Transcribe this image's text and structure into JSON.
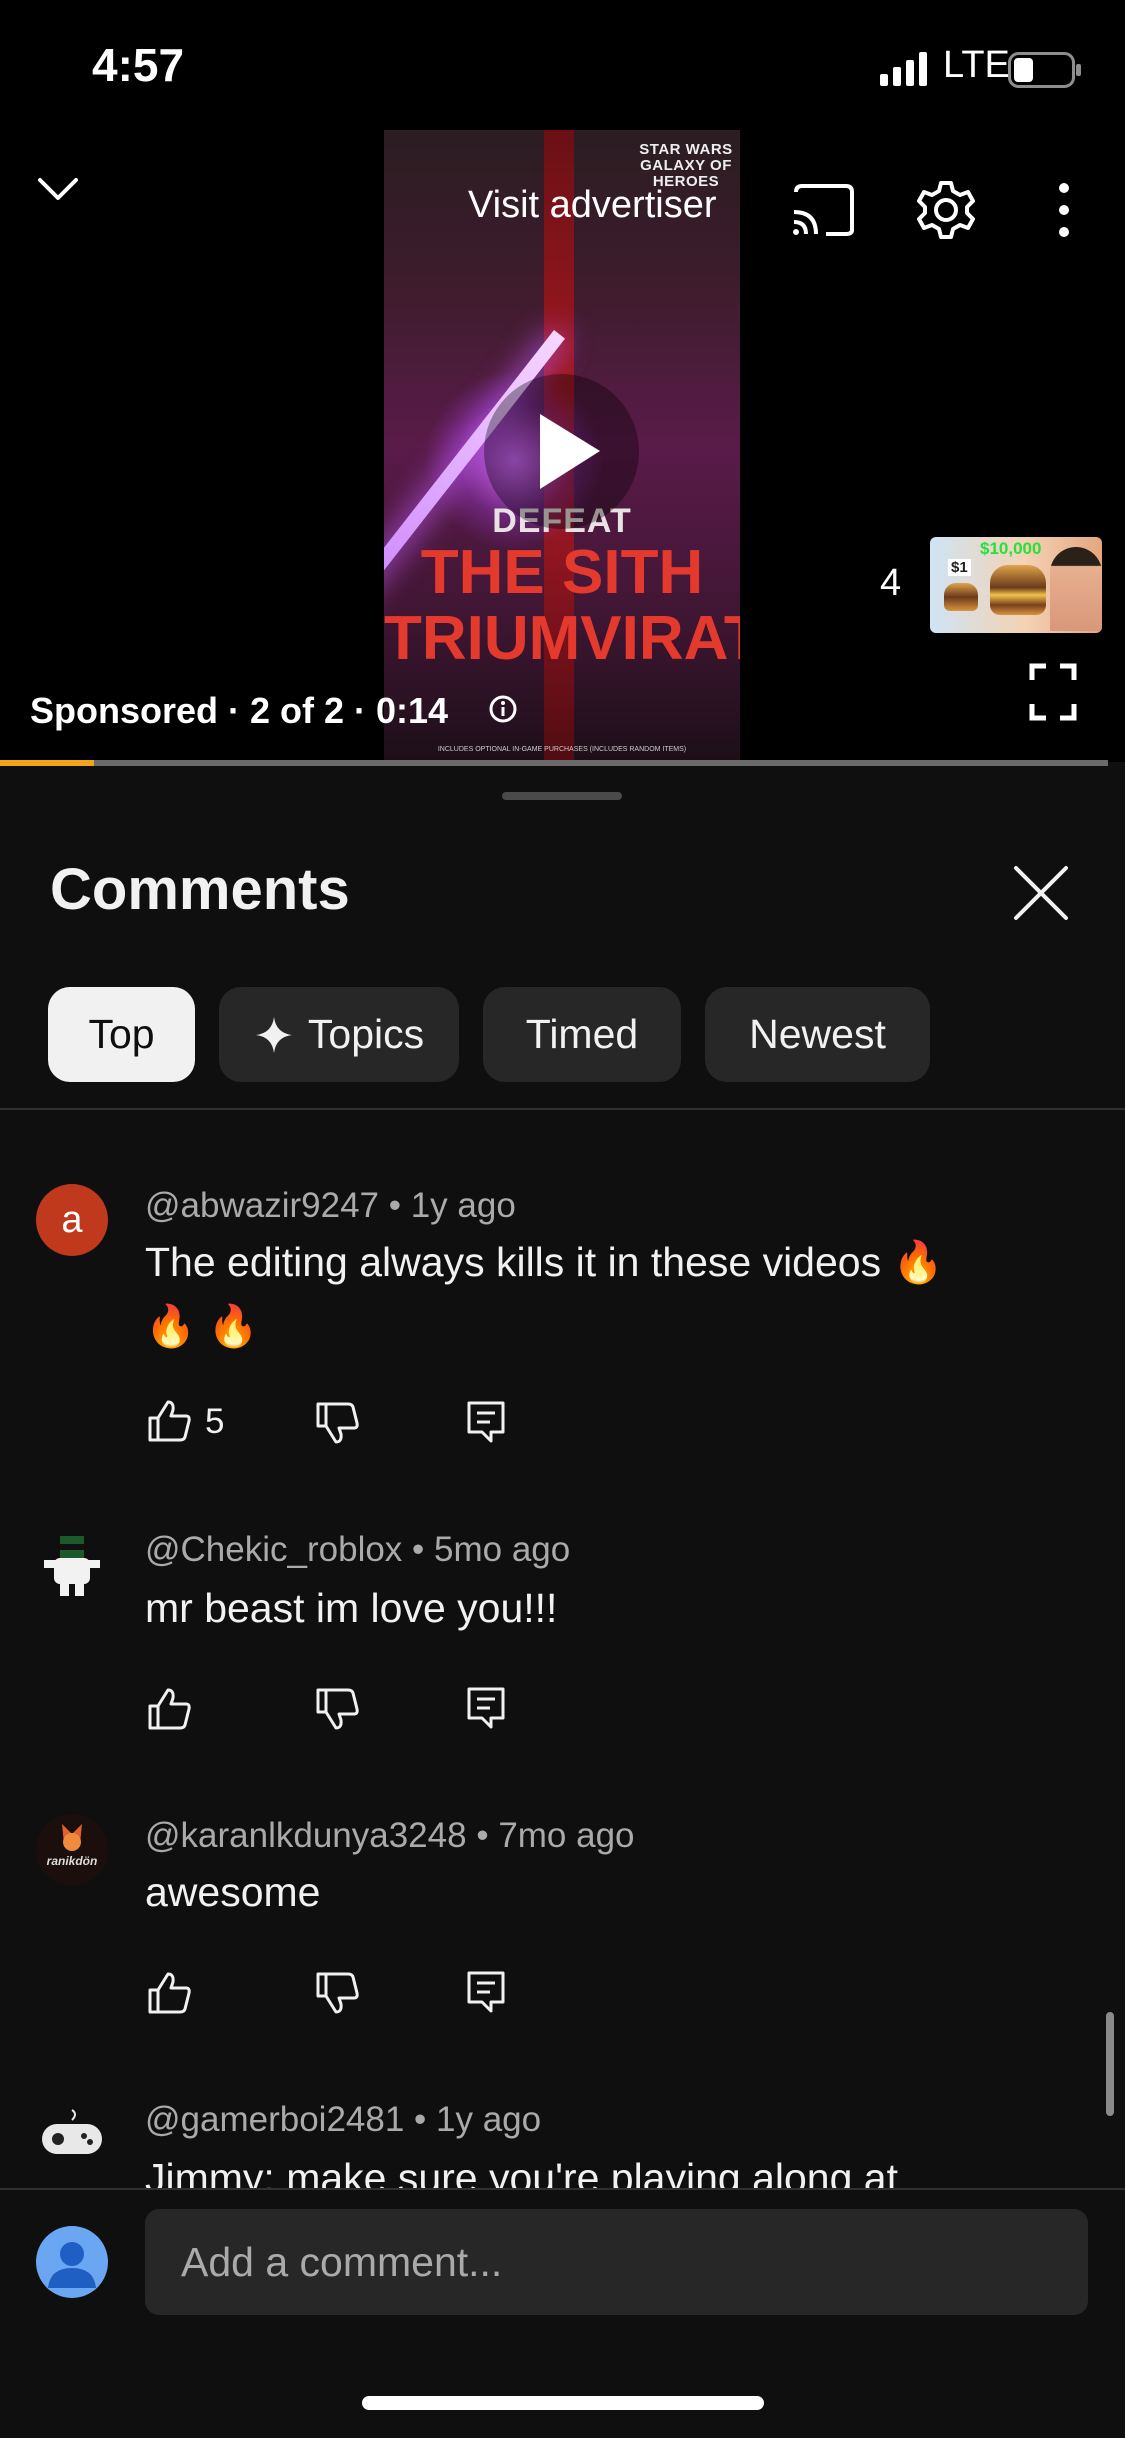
{
  "status_bar": {
    "time": "4:57",
    "network": "LTE",
    "battery_level": 0.35
  },
  "player": {
    "visit_advertiser": "Visit advertiser",
    "ad_creative": {
      "logo_text": "STAR WARS GALAXY OF HEROES",
      "line1": "DEFEAT",
      "line2": "THE SITH",
      "line3": "TRIUMVIRATE",
      "fine_print": "INCLUDES OPTIONAL IN-GAME PURCHASES (INCLUDES RANDOM ITEMS)"
    },
    "ad_info": "Sponsored · 2 of 2 · 0:14",
    "up_next_count": "4",
    "up_next_thumb": {
      "price_big": "$10,000",
      "price_small": "$1"
    },
    "progress": 0.085,
    "accent_color": "#f1a51c"
  },
  "comments_panel": {
    "title": "Comments",
    "chips": [
      {
        "label": "Top",
        "active": true
      },
      {
        "label": "Topics",
        "active": false,
        "icon": "sparkle-icon"
      },
      {
        "label": "Timed",
        "active": false
      },
      {
        "label": "Newest",
        "active": false
      }
    ],
    "comments": [
      {
        "avatar_letter": "a",
        "avatar_color": "#c1391c",
        "author": "@abwazir9247",
        "time": "1y ago",
        "text_line1": "The editing always kills it in these videos 🔥",
        "text_line2": "🔥 🔥",
        "likes": "5"
      },
      {
        "author": "@Chekic_roblox",
        "time": "5mo ago",
        "text_line1": "mr beast im love you!!!",
        "likes": ""
      },
      {
        "author": "@karanlkdunya3248",
        "time": "7mo ago",
        "avatar_text": "ranikdön",
        "text_line1": "awesome",
        "likes": ""
      },
      {
        "author": "@gamerboi2481",
        "time": "1y ago",
        "text_line1": "Jimmy: make sure you're playing along at"
      }
    ],
    "add_comment_placeholder": "Add a comment..."
  }
}
